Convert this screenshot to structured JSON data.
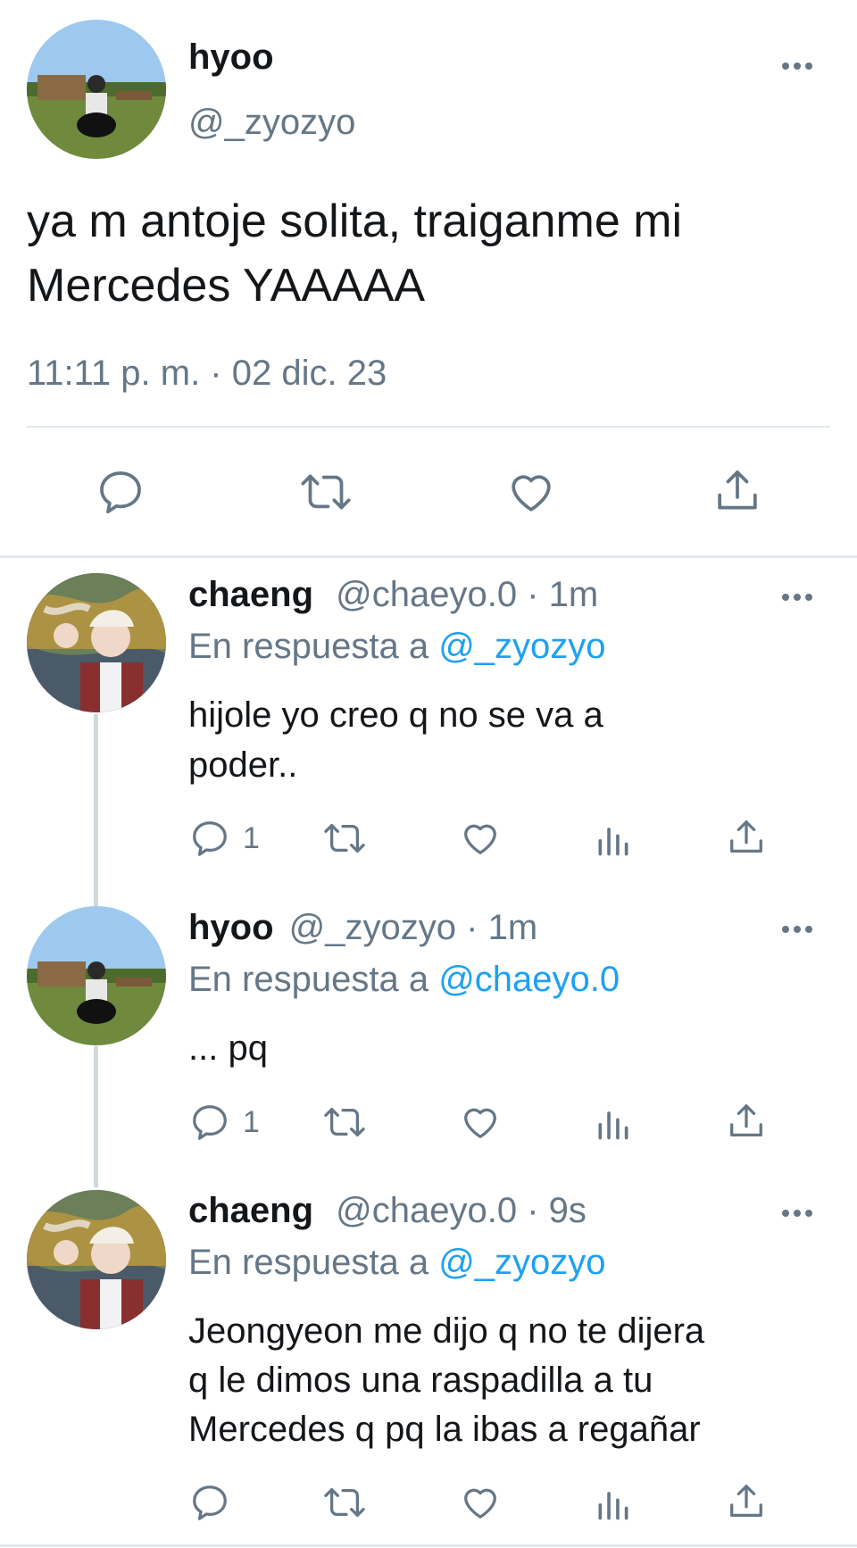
{
  "main_tweet": {
    "display_name": "hyoo",
    "handle": "@_zyozyo",
    "text_line1": "ya m antoje solita, traiganme mi",
    "text_line2": "Mercedes YAAAAA",
    "timestamp": "11:11 p. m. · 02 dic. 23",
    "actions": [
      "reply-icon",
      "retweet-icon",
      "like-icon",
      "share-icon"
    ]
  },
  "replies": [
    {
      "display_name": "chaeng",
      "handle": "@chaeyo.0",
      "time": "· 1m",
      "reply_prefix": "En respuesta a",
      "reply_to": "@_zyozyo",
      "text_line1": "hijole yo creo q no se va a",
      "text_line2": "poder..",
      "text_line3": "",
      "reply_count": "1"
    },
    {
      "display_name": "hyoo",
      "handle": "@_zyozyo",
      "time": "· 1m",
      "reply_prefix": "En respuesta a",
      "reply_to": "@chaeyo.0",
      "text_line1": "... pq",
      "text_line2": "",
      "text_line3": "",
      "reply_count": "1"
    },
    {
      "display_name": "chaeng",
      "handle": "@chaeyo.0",
      "time": "· 9s",
      "reply_prefix": "En respuesta a",
      "reply_to": "@_zyozyo",
      "text_line1": "Jeongyeon me dijo q no te dijera",
      "text_line2": "q le dimos una raspadilla a tu",
      "text_line3": "Mercedes q pq la ibas a regañar",
      "reply_count": ""
    }
  ],
  "colors": {
    "text": "#14171a",
    "secondary": "#657786",
    "link": "#1da1f2",
    "divider": "#e1e8ed"
  }
}
